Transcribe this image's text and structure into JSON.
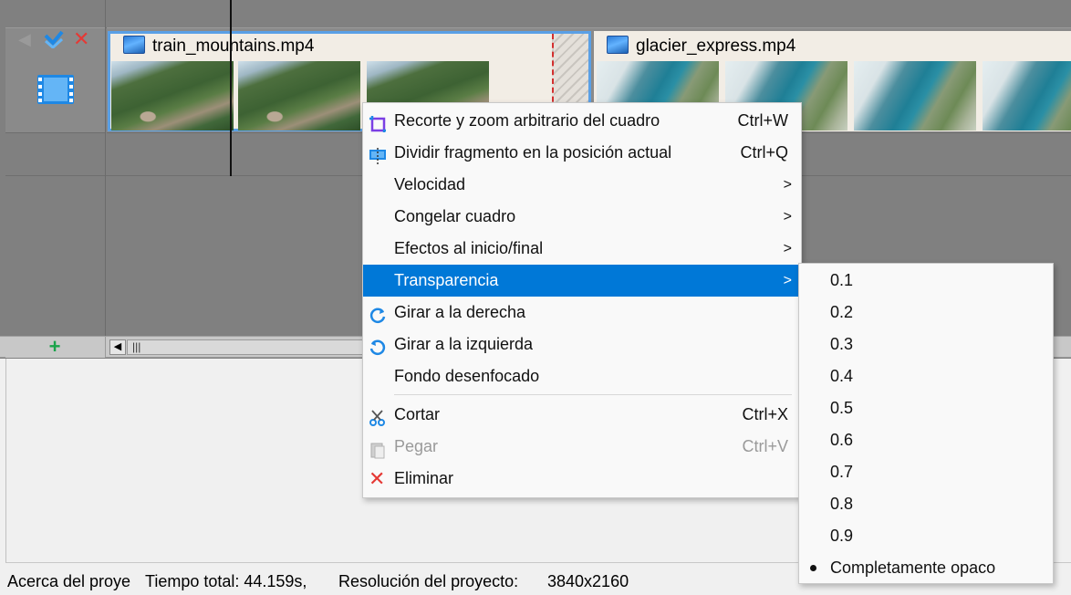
{
  "timeline": {
    "clips": [
      {
        "name": "train_mountains.mp4",
        "icon": "video-file-icon",
        "thumbnails": 3
      },
      {
        "name": "glacier_express.mp4",
        "icon": "video-file-icon",
        "thumbnails": 4
      }
    ],
    "track_icons": [
      "mute-icon",
      "check-icon",
      "delete-icon",
      "film-icon"
    ],
    "add_track_icon": "plus-icon",
    "scroll_thumb_text": "|||",
    "scroll_left_glyph": "◀"
  },
  "context_menu": {
    "items": [
      {
        "label": "Recorte y zoom arbitrario del cuadro",
        "shortcut": "Ctrl+W",
        "icon": "crop-icon"
      },
      {
        "label": "Dividir fragmento en la posición actual",
        "shortcut": "Ctrl+Q",
        "icon": "split-icon"
      },
      {
        "label": "Velocidad",
        "submenu": true
      },
      {
        "label": "Congelar cuadro",
        "submenu": true
      },
      {
        "label": "Efectos al inicio/final",
        "submenu": true
      },
      {
        "label": "Transparencia",
        "submenu": true,
        "highlighted": true
      },
      {
        "label": "Girar a la derecha",
        "icon": "rotate-right-icon"
      },
      {
        "label": "Girar a la izquierda",
        "icon": "rotate-left-icon"
      },
      {
        "label": "Fondo desenfocado"
      },
      {
        "label": "Cortar",
        "shortcut": "Ctrl+X",
        "icon": "scissors-icon"
      },
      {
        "label": "Pegar",
        "shortcut": "Ctrl+V",
        "icon": "paste-icon",
        "disabled": true
      },
      {
        "label": "Eliminar",
        "icon": "delete-icon"
      }
    ],
    "submenu_arrow": ">"
  },
  "transparency_submenu": {
    "items": [
      "0.1",
      "0.2",
      "0.3",
      "0.4",
      "0.5",
      "0.6",
      "0.7",
      "0.8",
      "0.9",
      "Completamente opaco"
    ],
    "selected": "Completamente opaco"
  },
  "status_bar": {
    "about": "Acerca del proye",
    "total_time": "Tiempo total: 44.159s,",
    "resolution_label": "Resolución del proyecto:",
    "resolution_value": "3840x2160"
  },
  "colors": {
    "highlight": "#0078d7",
    "timeline_bg": "#808080",
    "clip_selected_border": "#5aa0e6"
  }
}
